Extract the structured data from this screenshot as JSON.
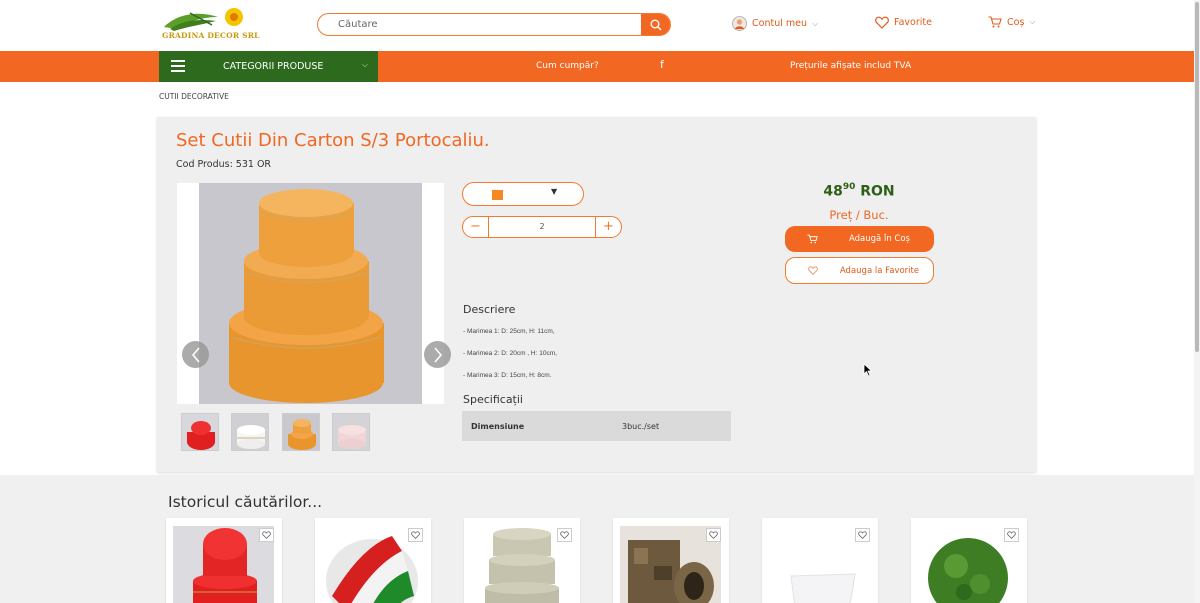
{
  "header": {
    "logo_text": "GRADINA DECOR SRL",
    "search_placeholder": "Căutare",
    "account_label": "Contul meu",
    "favorites_label": "Favorite",
    "cart_label": "Coș"
  },
  "nav": {
    "categories_label": "CATEGORII PRODUSE",
    "how_to_buy": "Cum cumpăr?",
    "vat_note": "Prețurile afișate includ TVA"
  },
  "breadcrumb": "CUTII DECORATIVE",
  "product": {
    "title": "Set Cutii Din Carton S/3 Portocaliu.",
    "code": "Cod Produs: 531 OR",
    "quantity": "2",
    "price_main": "48",
    "price_cents": "90",
    "currency": "RON",
    "unit": "Preț / Buc.",
    "add_to_cart": "Adaugă în Coș",
    "add_to_favorites": "Adauga la Favorite",
    "description_title": "Descriere",
    "description_lines": [
      "- Marimea 1: D: 25cm, H: 11cm,",
      "- Marimea 2: D: 20cm , H: 10cm,",
      "- Marimea 3: D: 15cm, H: 8cm."
    ],
    "spec_title": "Specificații",
    "spec_key": "Dimensiune",
    "spec_value": "3buc./set",
    "thumbnails": [
      "red",
      "white",
      "orange",
      "pink"
    ]
  },
  "history": {
    "title": "Istoricul căutărilor..."
  },
  "colors": {
    "brand_orange": "#f26722",
    "brand_green": "#2d6a1e",
    "price_green": "#2d5f16"
  }
}
